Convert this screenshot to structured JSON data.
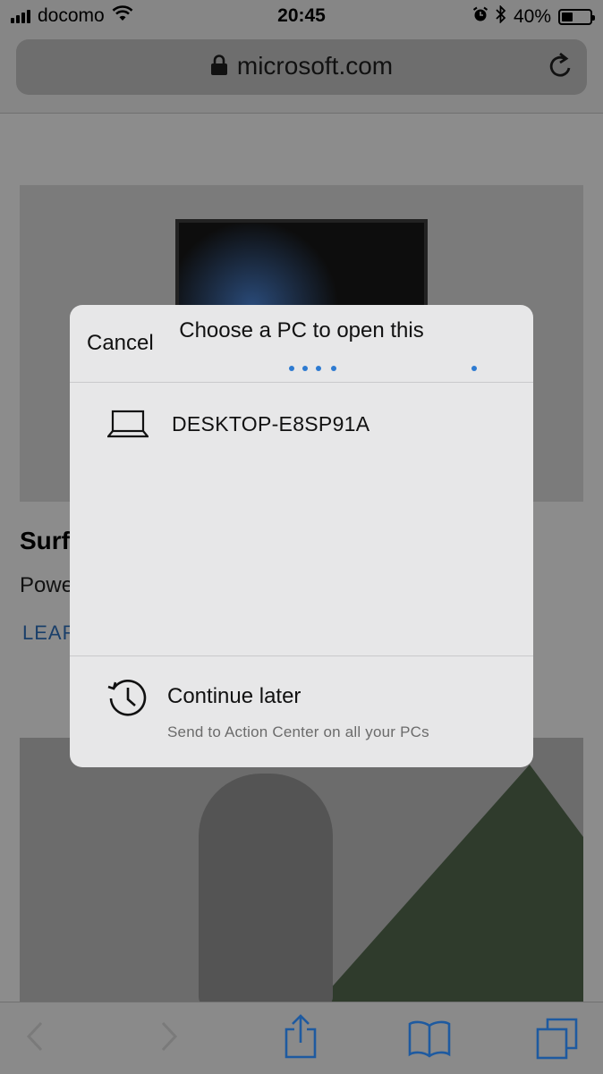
{
  "status": {
    "carrier": "docomo",
    "time": "20:45",
    "battery": "40%",
    "battery_level": 0.4,
    "icons": [
      "signal-icon",
      "wifi-icon",
      "alarm-icon",
      "bluetooth-icon",
      "battery-icon"
    ]
  },
  "browser": {
    "domain": "microsoft.com"
  },
  "page": {
    "product_title": "Surf",
    "product_subtitle": "Powe",
    "learn_link": "LEAR"
  },
  "modal": {
    "cancel_label": "Cancel",
    "title": "Choose a PC to open this",
    "devices": [
      {
        "name": "DESKTOP-E8SP91A",
        "icon": "laptop-icon"
      }
    ],
    "continue_later": {
      "label": "Continue later",
      "sublabel": "Send to Action Center on all your PCs",
      "icon": "history-icon"
    }
  },
  "toolbar": {
    "items": [
      "back-icon",
      "forward-icon",
      "share-icon",
      "bookmarks-icon",
      "tabs-icon"
    ]
  },
  "colors": {
    "accent": "#2e7bd1",
    "sheet_background": "#e7e7e8"
  }
}
